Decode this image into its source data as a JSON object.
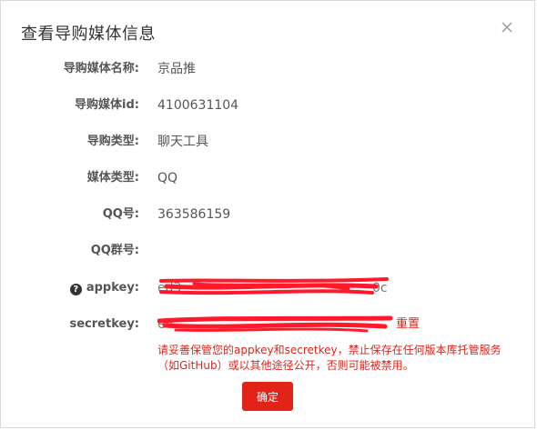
{
  "dialog": {
    "title": "查看导购媒体信息",
    "close_icon": "close-icon"
  },
  "fields": [
    {
      "label": "导购媒体名称:",
      "value": "京品推"
    },
    {
      "label": "导购媒体id:",
      "value": "4100631104"
    },
    {
      "label": "导购类型:",
      "value": "聊天工具"
    },
    {
      "label": "媒体类型:",
      "value": "QQ"
    },
    {
      "label": "QQ号:",
      "value": "363586159"
    },
    {
      "label": "QQ群号:",
      "value": ""
    }
  ],
  "appkey": {
    "label": "appkey:",
    "help_icon": "question-circle-icon",
    "visible_prefix": "ed3",
    "visible_suffix": "0c"
  },
  "secretkey": {
    "label": "secretkey:",
    "visible_prefix": "e6",
    "reset_label": "重置"
  },
  "warning_text": "请妥善保管您的appkey和secretkey，禁止保存在任何版本库托管服务（如GitHub）或以其他途径公开，否则可能被禁用。",
  "buttons": {
    "ok_label": "确定"
  },
  "colors": {
    "accent_red": "#e2231a",
    "text": "#555555"
  }
}
